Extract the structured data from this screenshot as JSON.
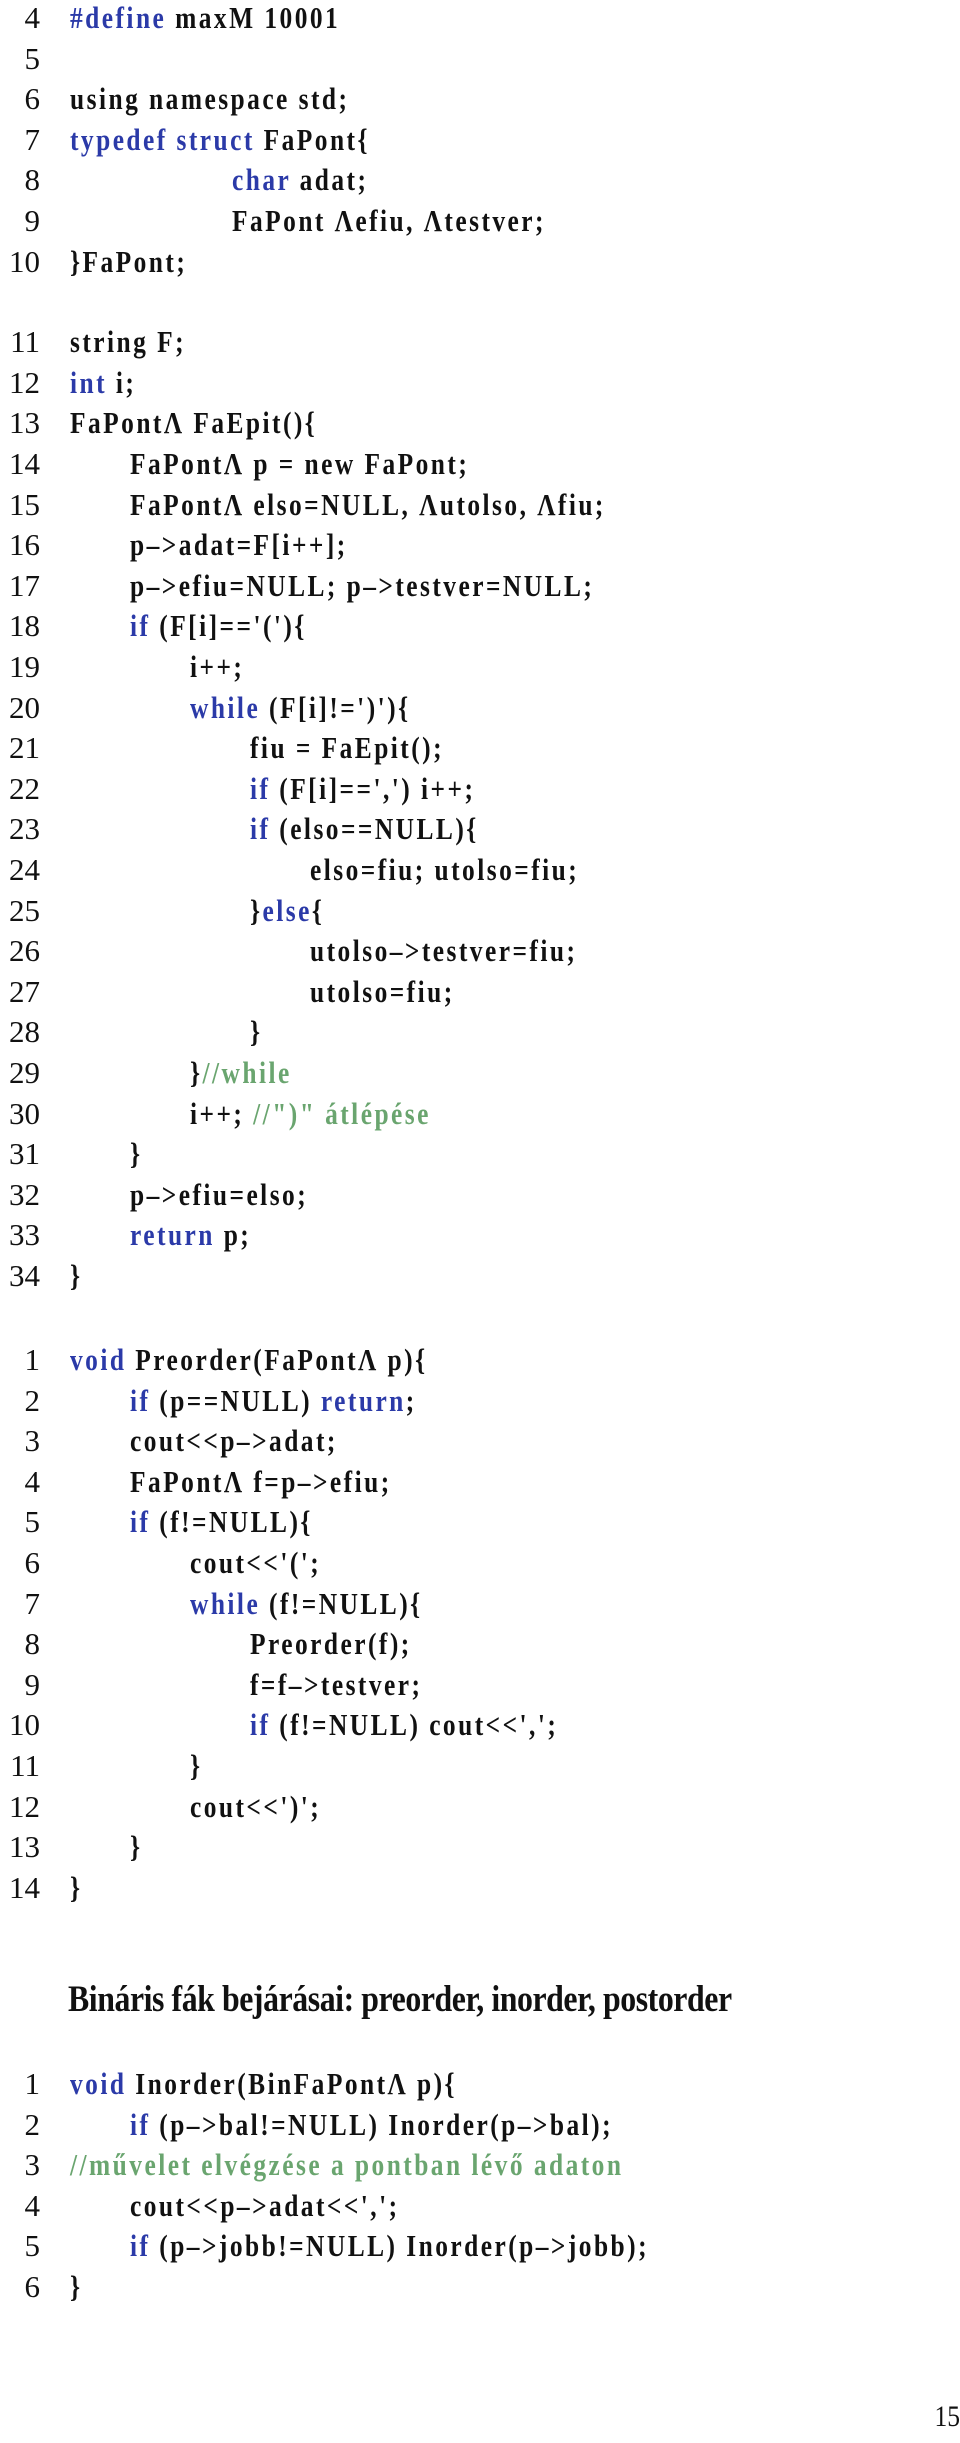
{
  "listings": [
    {
      "id": "faepit",
      "lines": [
        {
          "n": "4",
          "indent": 0,
          "tokens": [
            {
              "t": "#define",
              "k": "kw"
            },
            {
              "t": " maxM 10001",
              "k": ""
            }
          ]
        },
        {
          "n": "5",
          "indent": 0,
          "tokens": []
        },
        {
          "n": "6",
          "indent": 0,
          "tokens": [
            {
              "t": "using namespace std;",
              "k": ""
            }
          ]
        },
        {
          "n": "7",
          "indent": 0,
          "tokens": [
            {
              "t": "typedef",
              "k": "kw"
            },
            {
              "t": " ",
              "k": ""
            },
            {
              "t": "struct",
              "k": "kw"
            },
            {
              "t": " FaPont{",
              "k": ""
            }
          ]
        },
        {
          "n": "8",
          "indent": 4,
          "tokens": [
            {
              "t": "char",
              "k": "kw"
            },
            {
              "t": " adat;",
              "k": ""
            }
          ]
        },
        {
          "n": "9",
          "indent": 4,
          "tokens": [
            {
              "t": "FaPont Λefiu, Λtestver;",
              "k": ""
            }
          ]
        },
        {
          "n": "10",
          "indent": 0,
          "tokens": [
            {
              "t": "}FaPont;",
              "k": ""
            }
          ]
        },
        {
          "n": "11",
          "indent": 0,
          "gap": true,
          "tokens": [
            {
              "t": "string F;",
              "k": ""
            }
          ]
        },
        {
          "n": "12",
          "indent": 0,
          "tokens": [
            {
              "t": "int",
              "k": "kw"
            },
            {
              "t": " i;",
              "k": ""
            }
          ]
        },
        {
          "n": "13",
          "indent": 0,
          "tokens": [
            {
              "t": "FaPontΛ FaEpit(){",
              "k": ""
            }
          ]
        },
        {
          "n": "14",
          "indent": 1,
          "tokens": [
            {
              "t": "FaPontΛ p = new FaPont;",
              "k": ""
            }
          ]
        },
        {
          "n": "15",
          "indent": 1,
          "tokens": [
            {
              "t": "FaPontΛ elso=NULL, Λutolso, Λfiu;",
              "k": ""
            }
          ]
        },
        {
          "n": "16",
          "indent": 1,
          "tokens": [
            {
              "t": "p–>adat=F[i++];",
              "k": ""
            }
          ]
        },
        {
          "n": "17",
          "indent": 1,
          "tokens": [
            {
              "t": "p–>efiu=NULL; p–>testver=NULL;",
              "k": ""
            }
          ]
        },
        {
          "n": "18",
          "indent": 1,
          "tokens": [
            {
              "t": "if",
              "k": "kw"
            },
            {
              "t": " (F[i]=='('){",
              "k": ""
            }
          ]
        },
        {
          "n": "19",
          "indent": 2,
          "tokens": [
            {
              "t": "i++;",
              "k": ""
            }
          ]
        },
        {
          "n": "20",
          "indent": 2,
          "tokens": [
            {
              "t": "while",
              "k": "kw"
            },
            {
              "t": " (F[i]!=')'){",
              "k": ""
            }
          ]
        },
        {
          "n": "21",
          "indent": 3,
          "tokens": [
            {
              "t": "fiu = FaEpit();",
              "k": ""
            }
          ]
        },
        {
          "n": "22",
          "indent": 3,
          "tokens": [
            {
              "t": "if",
              "k": "kw"
            },
            {
              "t": " (F[i]==',') i++;",
              "k": ""
            }
          ]
        },
        {
          "n": "23",
          "indent": 3,
          "tokens": [
            {
              "t": "if",
              "k": "kw"
            },
            {
              "t": " (elso==NULL){",
              "k": ""
            }
          ]
        },
        {
          "n": "24",
          "indent": 4,
          "tokens": [
            {
              "t": "elso=fiu; utolso=fiu;",
              "k": ""
            }
          ]
        },
        {
          "n": "25",
          "indent": 3,
          "tokens": [
            {
              "t": "}",
              "k": ""
            },
            {
              "t": "else",
              "k": "kw"
            },
            {
              "t": "{",
              "k": ""
            }
          ]
        },
        {
          "n": "26",
          "indent": 4,
          "tokens": [
            {
              "t": "utolso–>testver=fiu;",
              "k": ""
            }
          ]
        },
        {
          "n": "27",
          "indent": 4,
          "tokens": [
            {
              "t": "utolso=fiu;",
              "k": ""
            }
          ]
        },
        {
          "n": "28",
          "indent": 3,
          "tokens": [
            {
              "t": "}",
              "k": ""
            }
          ]
        },
        {
          "n": "29",
          "indent": 2,
          "tokens": [
            {
              "t": "}",
              "k": ""
            },
            {
              "t": "//while",
              "k": "cm"
            }
          ]
        },
        {
          "n": "30",
          "indent": 2,
          "tokens": [
            {
              "t": "i++; ",
              "k": ""
            },
            {
              "t": "//\")\" átlépése",
              "k": "cm"
            }
          ]
        },
        {
          "n": "31",
          "indent": 1,
          "tokens": [
            {
              "t": "}",
              "k": ""
            }
          ]
        },
        {
          "n": "32",
          "indent": 1,
          "tokens": [
            {
              "t": "p–>efiu=elso;",
              "k": ""
            }
          ]
        },
        {
          "n": "33",
          "indent": 1,
          "tokens": [
            {
              "t": "return",
              "k": "kw"
            },
            {
              "t": " p;",
              "k": ""
            }
          ]
        },
        {
          "n": "34",
          "indent": 0,
          "tokens": [
            {
              "t": "}",
              "k": ""
            }
          ]
        }
      ]
    },
    {
      "id": "preorder",
      "lines": [
        {
          "n": "1",
          "indent": 0,
          "tokens": [
            {
              "t": "void",
              "k": "kw"
            },
            {
              "t": " Preorder(FaPontΛ p){",
              "k": ""
            }
          ]
        },
        {
          "n": "2",
          "indent": 1,
          "tokens": [
            {
              "t": "if",
              "k": "kw"
            },
            {
              "t": " (p==NULL) ",
              "k": ""
            },
            {
              "t": "return",
              "k": "kw"
            },
            {
              "t": ";",
              "k": ""
            }
          ]
        },
        {
          "n": "3",
          "indent": 1,
          "tokens": [
            {
              "t": "cout<<p–>adat;",
              "k": ""
            }
          ]
        },
        {
          "n": "4",
          "indent": 1,
          "tokens": [
            {
              "t": "FaPontΛ f=p–>efiu;",
              "k": ""
            }
          ]
        },
        {
          "n": "5",
          "indent": 1,
          "tokens": [
            {
              "t": "if",
              "k": "kw"
            },
            {
              "t": " (f!=NULL){",
              "k": ""
            }
          ]
        },
        {
          "n": "6",
          "indent": 2,
          "tokens": [
            {
              "t": "cout<<'(';",
              "k": ""
            }
          ]
        },
        {
          "n": "7",
          "indent": 2,
          "tokens": [
            {
              "t": "while",
              "k": "kw"
            },
            {
              "t": " (f!=NULL){",
              "k": ""
            }
          ]
        },
        {
          "n": "8",
          "indent": 3,
          "tokens": [
            {
              "t": "Preorder(f);",
              "k": ""
            }
          ]
        },
        {
          "n": "9",
          "indent": 3,
          "tokens": [
            {
              "t": "f=f–>testver;",
              "k": ""
            }
          ]
        },
        {
          "n": "10",
          "indent": 3,
          "tokens": [
            {
              "t": "if",
              "k": "kw"
            },
            {
              "t": " (f!=NULL) cout<<',';",
              "k": ""
            }
          ]
        },
        {
          "n": "11",
          "indent": 2,
          "tokens": [
            {
              "t": "}",
              "k": ""
            }
          ]
        },
        {
          "n": "12",
          "indent": 2,
          "tokens": [
            {
              "t": "cout<<')';",
              "k": ""
            }
          ]
        },
        {
          "n": "13",
          "indent": 1,
          "tokens": [
            {
              "t": "}",
              "k": ""
            }
          ]
        },
        {
          "n": "14",
          "indent": 0,
          "tokens": [
            {
              "t": "}",
              "k": ""
            }
          ]
        }
      ]
    },
    {
      "id": "inorder",
      "lines": [
        {
          "n": "1",
          "indent": 0,
          "tokens": [
            {
              "t": "void",
              "k": "kw"
            },
            {
              "t": " Inorder(BinFaPontΛ p){",
              "k": ""
            }
          ]
        },
        {
          "n": "2",
          "indent": 1,
          "tokens": [
            {
              "t": "if",
              "k": "kw"
            },
            {
              "t": " (p–>bal!=NULL) Inorder(p–>bal);",
              "k": ""
            }
          ]
        },
        {
          "n": "3",
          "indent": 0,
          "tokens": [
            {
              "t": "//művelet elvégzése a pontban lévő adaton",
              "k": "cm"
            }
          ]
        },
        {
          "n": "4",
          "indent": 1,
          "tokens": [
            {
              "t": "cout<<p–>adat<<',';",
              "k": ""
            }
          ]
        },
        {
          "n": "5",
          "indent": 1,
          "tokens": [
            {
              "t": "if",
              "k": "kw"
            },
            {
              "t": " (p–>jobb!=NULL) Inorder(p–>jobb);",
              "k": ""
            }
          ]
        },
        {
          "n": "6",
          "indent": 0,
          "tokens": [
            {
              "t": "}",
              "k": ""
            }
          ]
        }
      ]
    }
  ],
  "section_heading": "Bináris fák bejárásai: preorder, inorder, postorder",
  "page_number": "15",
  "colors": {
    "keyword": "#2b3aa8",
    "comment": "#6aa56f",
    "text": "#111111"
  }
}
